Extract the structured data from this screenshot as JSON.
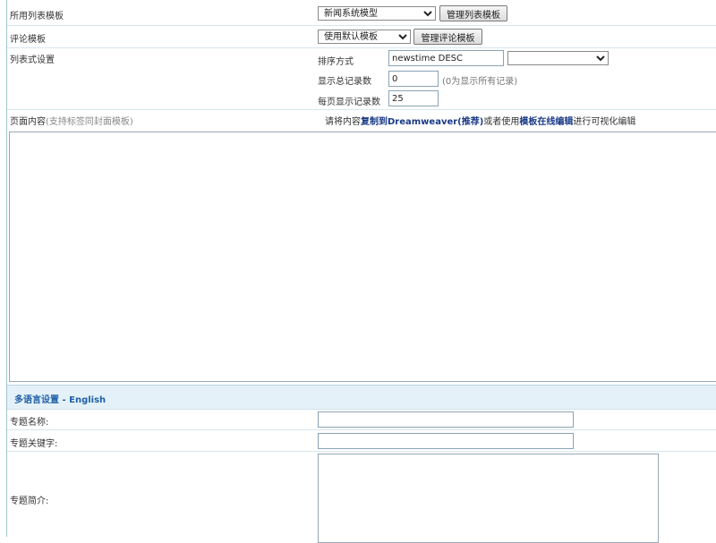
{
  "list_template": {
    "label": "所用列表模板",
    "selected": "新闻系统模型",
    "manage_button": "管理列表模板"
  },
  "comment_template": {
    "label": "评论模板",
    "selected": "使用默认模板",
    "manage_button": "管理评论模板"
  },
  "list_settings": {
    "label": "列表式设置",
    "sort_label": "排序方式",
    "sort_value": "newstime DESC",
    "sort_select": "",
    "total_label": "显示总记录数",
    "total_value": "0",
    "total_note": "(0为显示所有记录)",
    "per_page_label": "每页显示记录数",
    "per_page_value": "25"
  },
  "page_content": {
    "label": "页面内容",
    "label_note": "(支持标签同封面模板)",
    "hint_prefix": "请将内容",
    "hint_link1": "复制到Dreamweaver(推荐)",
    "hint_middle": "或者使用",
    "hint_link2": "模板在线编辑",
    "hint_suffix": "进行可视化编辑",
    "content": ""
  },
  "multilang": {
    "title": "多语言设置 - English",
    "name_label": "专题名称:",
    "name_value": "",
    "keywords_label": "专题关键字:",
    "keywords_value": "",
    "intro_label": "专题简介:",
    "intro_value": ""
  }
}
